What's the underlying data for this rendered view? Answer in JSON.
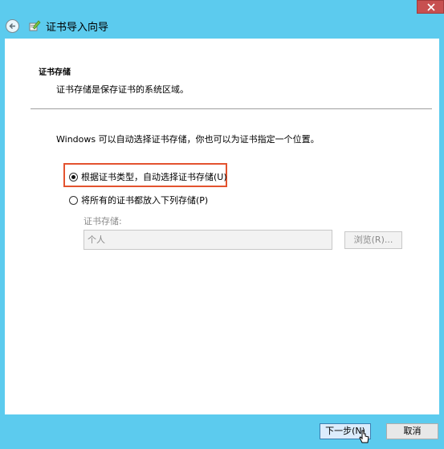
{
  "window": {
    "title": "证书导入向导"
  },
  "page": {
    "heading": "证书存储",
    "description": "证书存储是保存证书的系统区域。",
    "intro": "Windows 可以自动选择证书存储，你也可以为证书指定一个位置。"
  },
  "options": [
    {
      "label": "根据证书类型，自动选择证书存储(U)",
      "checked": true
    },
    {
      "label": "将所有的证书都放入下列存储(P)",
      "checked": false
    }
  ],
  "store": {
    "label": "证书存储:",
    "value": "个人",
    "browse_label": "浏览(R)..."
  },
  "footer": {
    "next_label": "下一步(N)",
    "cancel_label": "取消"
  },
  "colors": {
    "title_bar": "#5ccbee",
    "highlight": "#e3532f",
    "close_button": "#c75050"
  },
  "icons": {
    "close": "close-icon",
    "back": "back-arrow-icon",
    "wizard": "certificate-wizard-icon",
    "cursor": "mouse-pointer-icon"
  }
}
